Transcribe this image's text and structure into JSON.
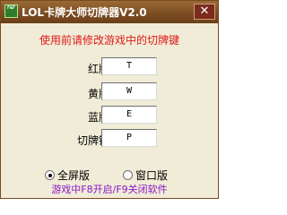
{
  "window": {
    "title": "LOL卡牌大师切牌器V2.0",
    "icon_text": "F&F",
    "close_glyph": "✕",
    "close_icon": "close-icon"
  },
  "instruction": "使用前请修改游戏中的切牌键",
  "fields": [
    {
      "label": "红牌:",
      "value": "T"
    },
    {
      "label": "黄牌:",
      "value": "W"
    },
    {
      "label": "蓝牌:",
      "value": "E"
    },
    {
      "label": "切牌键:",
      "value": "P"
    }
  ],
  "modes": [
    {
      "label": "全屏版",
      "selected": true
    },
    {
      "label": "窗口版",
      "selected": false
    }
  ],
  "footer": "游戏中F8开启/F9关闭软件",
  "colors": {
    "instruction": "#e01818",
    "footer": "#8a18c8",
    "titlebar": "#7c4d22",
    "background": "#f0ecd7"
  }
}
